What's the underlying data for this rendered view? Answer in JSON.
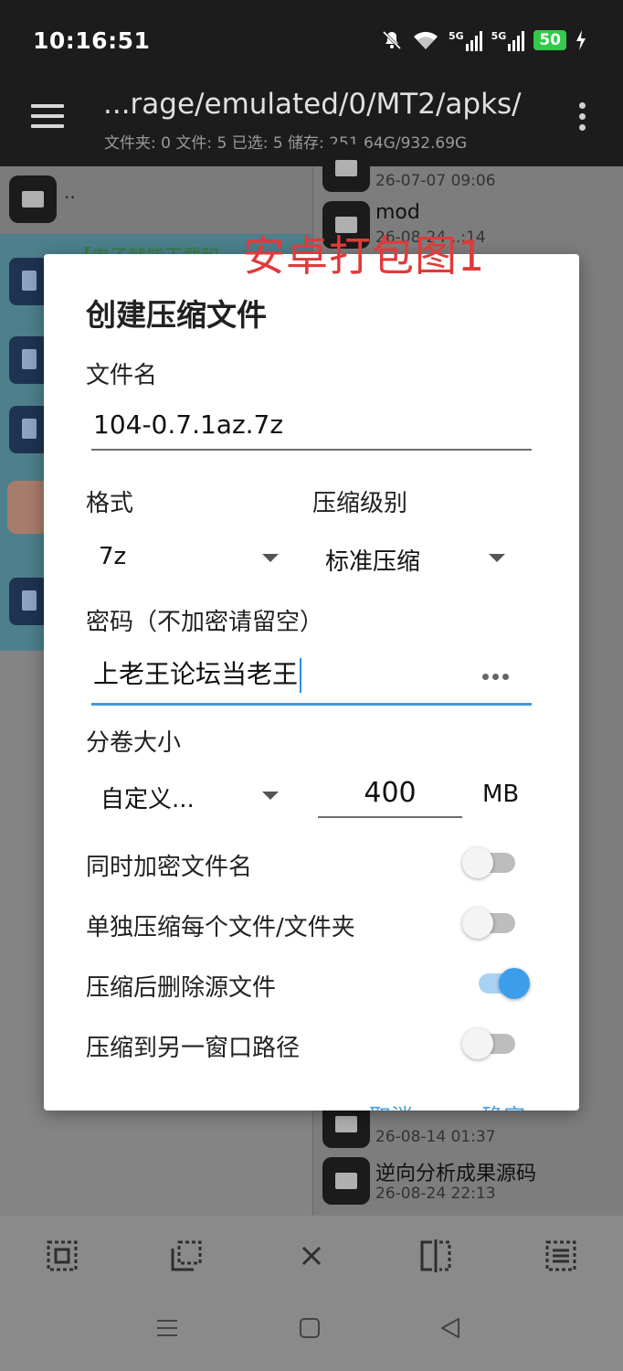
{
  "status": {
    "time": "10:16:51",
    "signal1": "5G",
    "signal2": "5G",
    "battery": "50",
    "icons": [
      "mute-icon",
      "wifi-icon",
      "signal-5g-icon",
      "signal-5g-icon",
      "battery-icon",
      "charging-icon"
    ]
  },
  "header": {
    "path": "...rage/emulated/0/MT2/apks/",
    "info": "文件夹: 0  文件: 5  已选: 5  储存: 251.64G/932.69G"
  },
  "left_pane": {
    "parent": "..",
    "hint": "【电子就能下载和"
  },
  "right_pane": {
    "items": [
      {
        "name": "",
        "date": "26-07-07 09:06"
      },
      {
        "name": "mod",
        "date": "26-08-24 ..:14"
      },
      {
        "name": "",
        "date": "26-08-14 01:37"
      },
      {
        "name": "逆向分析成果源码",
        "date": "26-08-24 22:13"
      }
    ]
  },
  "watermark": "安卓打包图1",
  "dialog": {
    "title": "创建压缩文件",
    "filename_label": "文件名",
    "filename_value": "104-0.7.1az.7z",
    "format_label": "格式",
    "format_value": "7z",
    "level_label": "压缩级别",
    "level_value": "标准压缩",
    "password_label": "密码（不加密请留空）",
    "password_value": "上老王论坛当老王",
    "split_label": "分卷大小",
    "split_value": "自定义...",
    "split_size": "400",
    "split_unit": "MB",
    "options": [
      {
        "label": "同时加密文件名",
        "on": false
      },
      {
        "label": "单独压缩每个文件/文件夹",
        "on": false
      },
      {
        "label": "压缩后删除源文件",
        "on": true
      },
      {
        "label": "压缩到另一窗口路径",
        "on": false
      }
    ],
    "cancel": "取消",
    "ok": "确定"
  },
  "toolbar": {
    "icons": [
      "select-all-icon",
      "select-copy-icon",
      "close-icon",
      "split-view-icon",
      "list-icon"
    ]
  },
  "navbar": {
    "icons": [
      "menu-nav-icon",
      "home-nav-icon",
      "back-nav-icon"
    ]
  }
}
